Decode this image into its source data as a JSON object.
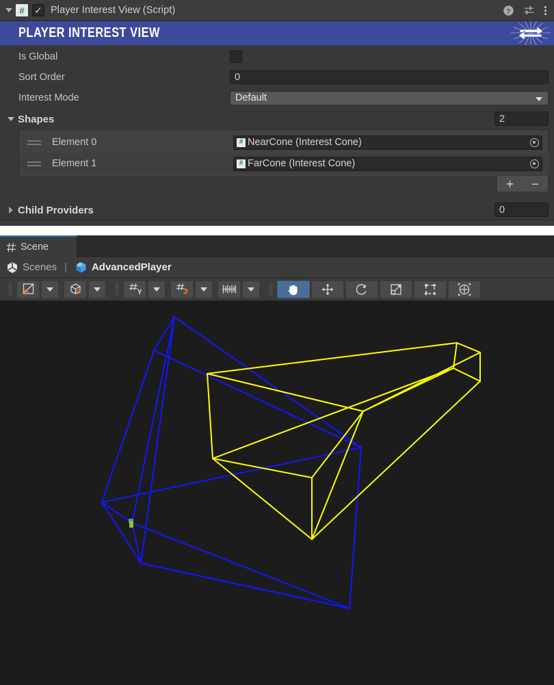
{
  "inspector": {
    "component_header": {
      "title": "Player Interest View (Script)",
      "script_icon": "csharp-script-icon",
      "enabled_checkmark": "✓",
      "help_icon": "help-icon",
      "preset_icon": "preset-sliders-icon",
      "menu_icon": "kebab-menu-icon"
    },
    "banner": {
      "title": "PLAYER INTEREST VIEW",
      "color": "#3c4a9c",
      "logo": "exchange-arrows-logo"
    },
    "properties": [
      {
        "label": "Is Global",
        "type": "checkbox",
        "value": "",
        "checked": false
      },
      {
        "label": "Sort Order",
        "type": "number",
        "value": "0"
      },
      {
        "label": "Interest Mode",
        "type": "dropdown",
        "value": "Default"
      }
    ],
    "shapes": {
      "label": "Shapes",
      "size": "2",
      "expanded": true,
      "elements": [
        {
          "label": "Element 0",
          "value": "NearCone (Interest Cone)",
          "icon": "csharp-script-icon"
        },
        {
          "label": "Element 1",
          "value": "FarCone (Interest Cone)",
          "icon": "csharp-script-icon"
        }
      ],
      "add_label": "+",
      "remove_label": "−"
    },
    "child_providers": {
      "label": "Child Providers",
      "size": "0",
      "expanded": false
    }
  },
  "scene": {
    "tab": {
      "label": "Scene",
      "icon": "scene-grid-icon"
    },
    "breadcrumb": [
      {
        "label": "Scenes",
        "icon": "unity-scene-icon",
        "active": false
      },
      {
        "label": "AdvancedPlayer",
        "icon": "prefab-cube-icon",
        "active": true
      }
    ],
    "toolbar": {
      "groups": [
        {
          "name": "draw-mode",
          "icon": "shading-mode-icon",
          "has_dropdown": true
        },
        {
          "name": "2d-3d-gizmos",
          "icon": "gizmo-cube-icon",
          "has_dropdown": true
        },
        {
          "name": "grid-axis",
          "icon": "grid-y-axis-icon",
          "has_dropdown": true
        },
        {
          "name": "grid-snap",
          "icon": "grid-snap-magnet-icon",
          "has_dropdown": true
        },
        {
          "name": "increment-snap",
          "icon": "ruler-snap-icon",
          "has_dropdown": true
        }
      ],
      "tools": [
        {
          "name": "hand-tool",
          "icon": "hand-icon",
          "selected": true
        },
        {
          "name": "move-tool",
          "icon": "move-arrows-icon",
          "selected": false
        },
        {
          "name": "rotate-tool",
          "icon": "rotate-icon",
          "selected": false
        },
        {
          "name": "scale-tool",
          "icon": "scale-icon",
          "selected": false
        },
        {
          "name": "rect-tool",
          "icon": "rect-transform-icon",
          "selected": false
        },
        {
          "name": "transform-tool",
          "icon": "transform-tool-icon",
          "selected": false
        }
      ],
      "selected_tool": "hand-tool"
    },
    "viewport": {
      "background": "#1c1c1c",
      "gizmos": [
        {
          "name": "NearCone",
          "color": "#1414ff",
          "shape": "frustum-wireframe"
        },
        {
          "name": "FarCone",
          "color": "#ffff00",
          "shape": "frustum-wireframe"
        }
      ],
      "origin_marker_color": "#9bbf2a"
    }
  }
}
